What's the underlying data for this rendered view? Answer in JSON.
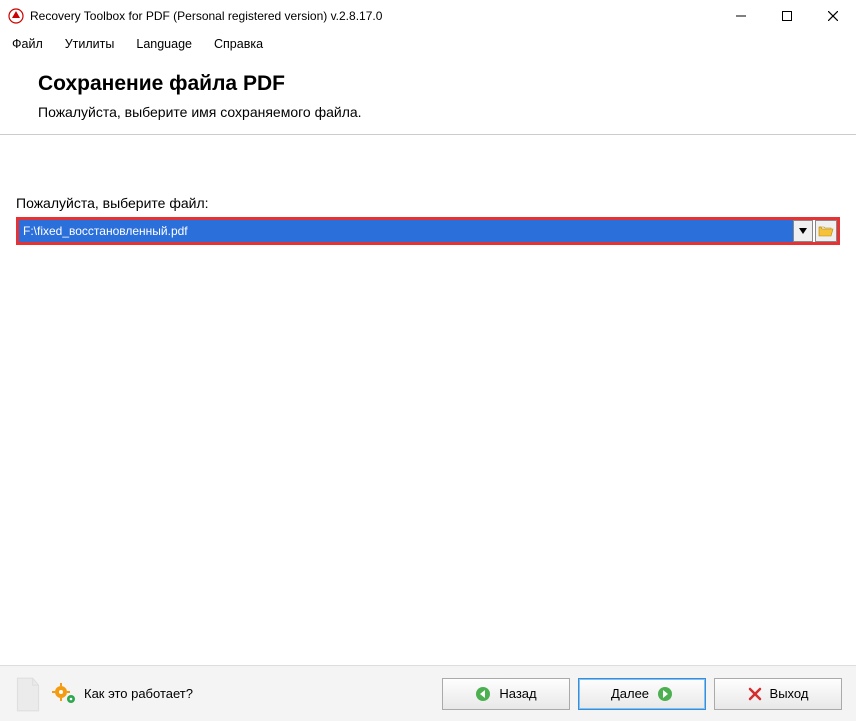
{
  "window": {
    "title": "Recovery Toolbox for PDF (Personal registered version) v.2.8.17.0"
  },
  "menu": {
    "file": "Файл",
    "utilities": "Утилиты",
    "language": "Language",
    "help": "Справка"
  },
  "header": {
    "title": "Сохранение файла PDF",
    "subtitle": "Пожалуйста, выберите имя сохраняемого файла."
  },
  "content": {
    "field_label": "Пожалуйста, выберите файл:",
    "file_path": "F:\\fixed_восстановленный.pdf"
  },
  "footer": {
    "how_it_works": "Как это работает?",
    "back": "Назад",
    "next": "Далее",
    "exit": "Выход"
  }
}
